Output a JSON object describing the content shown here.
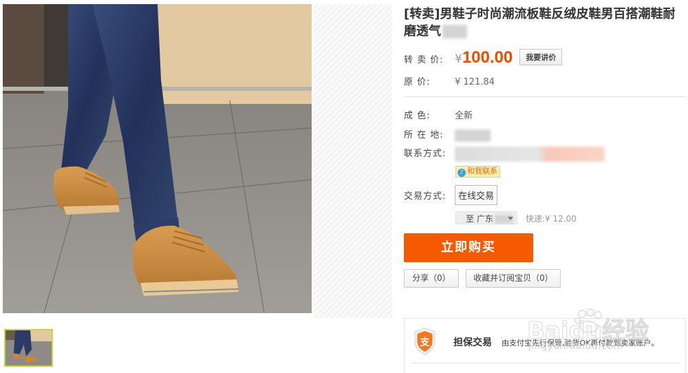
{
  "product": {
    "title": "[转卖]男鞋子时尚潮流板鞋反绒皮鞋男百搭潮鞋耐磨透气"
  },
  "price": {
    "label": "转 卖 价:",
    "currency": "¥",
    "value": "100.00",
    "bargain_button": "我要讲价"
  },
  "original_price": {
    "label": "原      价:",
    "value": "¥ 121.84"
  },
  "details": {
    "condition_label": "成      色:",
    "condition_value": "全新",
    "location_label": "所 在 地:",
    "contact_label": "联系方式:",
    "contact_tag": "和我联系",
    "trade_label": "交易方式:",
    "trade_value": "在线交易"
  },
  "shipping": {
    "destination": "至 广东",
    "fee": "快递:¥ 12.00"
  },
  "actions": {
    "buy_now": "立即购买",
    "share": "分享（0）",
    "favorite": "收藏并订阅宝贝（0）"
  },
  "guarantee": {
    "title": "担保交易",
    "description": "由支付宝先行保管,验货OK再付款到卖家账户。",
    "icon": "alipay-shield-icon"
  },
  "watermark": {
    "brand": "Baidu经验",
    "url": "jingyan.baidu.com"
  },
  "colors": {
    "price": "#f04c00",
    "buy_button": "#f55a00",
    "thumb_border": "#c5d63e"
  }
}
